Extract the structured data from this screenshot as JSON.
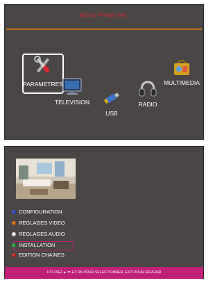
{
  "main_menu": {
    "title": "MENU PRINCIPAL",
    "items": [
      {
        "label": "PARAMETRES",
        "icon": "tools-icon"
      },
      {
        "label": "TELEVISION",
        "icon": "tv-icon"
      },
      {
        "label": "USB",
        "icon": "usb-stick-icon"
      },
      {
        "label": "RADIO",
        "icon": "headphones-icon"
      },
      {
        "label": "MULTIMEDIA",
        "icon": "media-bag-icon"
      }
    ],
    "selected": "PARAMETRES"
  },
  "settings_menu": {
    "items": [
      {
        "label": "CONFIGURATION",
        "color": "#3b5bd6"
      },
      {
        "label": "REGLAGES VIDEO",
        "color": "#e07a1e"
      },
      {
        "label": "REGLAGES AUDIO",
        "color": "#ffffff"
      },
      {
        "label": "INSTALLATION",
        "color": "#2fb44a"
      },
      {
        "label": "EDITION CHAINES",
        "color": "#d83030"
      }
    ],
    "selected": "INSTALLATION"
  },
  "footer": {
    "hint": "UTILISEZ▲/▼,ET OK POUR SELECTIONNER, EXIT POUR REVENIR"
  },
  "colors": {
    "panel_bg": "#4a4646",
    "accent_orange": "#c8721a",
    "title_red": "#d8262a",
    "footer_magenta": "#c01f7a"
  }
}
